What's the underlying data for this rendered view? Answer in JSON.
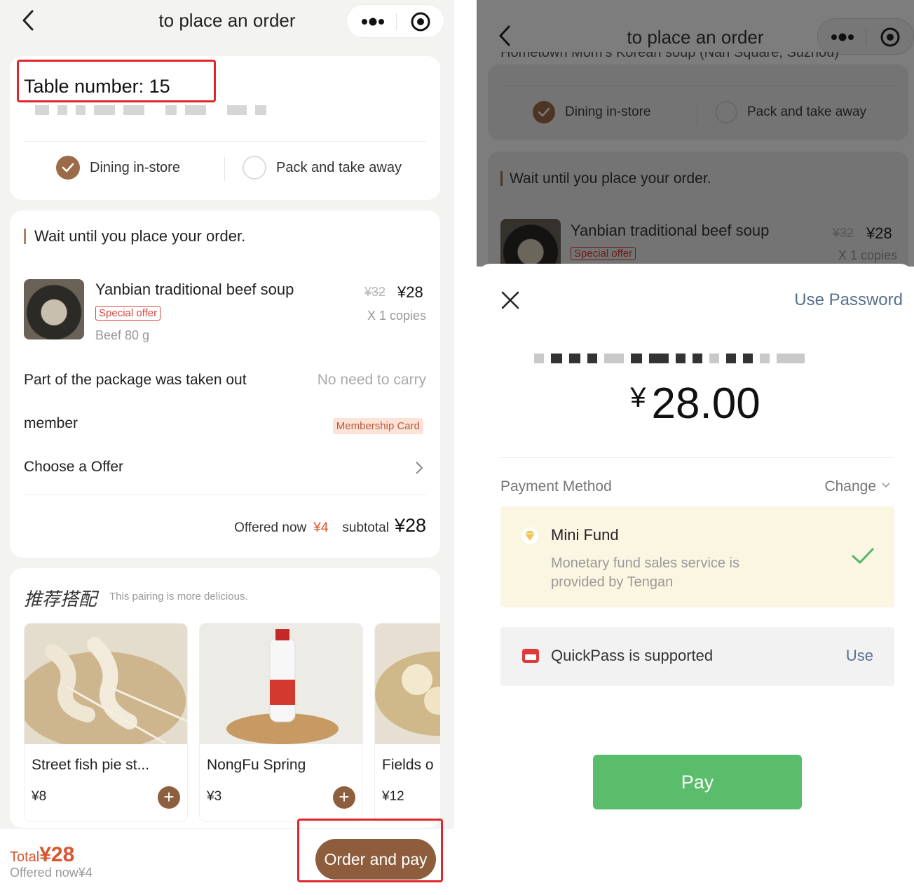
{
  "left": {
    "nav": {
      "title": "to place an order"
    },
    "table": {
      "number_text": "Table number: 15"
    },
    "dine_options": [
      {
        "label": "Dining in-store",
        "selected": true
      },
      {
        "label": "Pack and take away",
        "selected": false
      }
    ],
    "order": {
      "section_title": "Wait until you place your order.",
      "item": {
        "name": "Yanbian traditional beef soup",
        "tag": "Special offer",
        "spec": "Beef 80 g",
        "old_price": "¥32",
        "price": "¥28",
        "copies": "X 1 copies"
      },
      "package_label": "Part of the package was taken out",
      "package_value": "No need to carry",
      "member_label": "member",
      "member_tag": "Membership Card",
      "offer_label": "Choose a Offer",
      "offered_label": "Offered now",
      "offered_value": "¥4",
      "subtotal_label": "subtotal",
      "subtotal_value": "¥28"
    },
    "recommend": {
      "title_cn": "推荐搭配",
      "subtitle": "This pairing is more delicious.",
      "items": [
        {
          "name": "Street fish pie st...",
          "price": "¥8"
        },
        {
          "name": "NongFu Spring",
          "price": "¥3"
        },
        {
          "name": "Fields o",
          "price": "¥12"
        }
      ]
    },
    "bottom": {
      "total_label": "Total",
      "total_value": "¥28",
      "offered": "Offered now¥4",
      "pay_button": "Order and pay"
    }
  },
  "right": {
    "nav": {
      "title": "to place an order"
    },
    "cut_text": "Hometown Mom's Korean soup (Nan Square, Suzhou)",
    "dine_options": [
      {
        "label": "Dining in-store",
        "selected": true
      },
      {
        "label": "Pack and take away",
        "selected": false
      }
    ],
    "order": {
      "section_title": "Wait until you place your order.",
      "item_name": "Yanbian traditional beef soup",
      "tag": "Special offer",
      "old_price": "¥32",
      "price": "¥28",
      "copies": "X 1 copies"
    },
    "sheet": {
      "use_password": "Use Password",
      "currency": "¥",
      "amount": "28.00",
      "payment_method_label": "Payment Method",
      "change_label": "Change",
      "fund_name": "Mini Fund",
      "fund_desc": "Monetary fund sales service is provided by Tengan",
      "quickpass_text": "QuickPass is supported",
      "quickpass_use": "Use",
      "pay_button": "Pay"
    }
  },
  "colors": {
    "brand_brown": "#8d5d3d",
    "highlight_red": "#e0262a",
    "price_orange": "#e0552b",
    "pay_green": "#59bd6b",
    "link_blue": "#55708e"
  }
}
